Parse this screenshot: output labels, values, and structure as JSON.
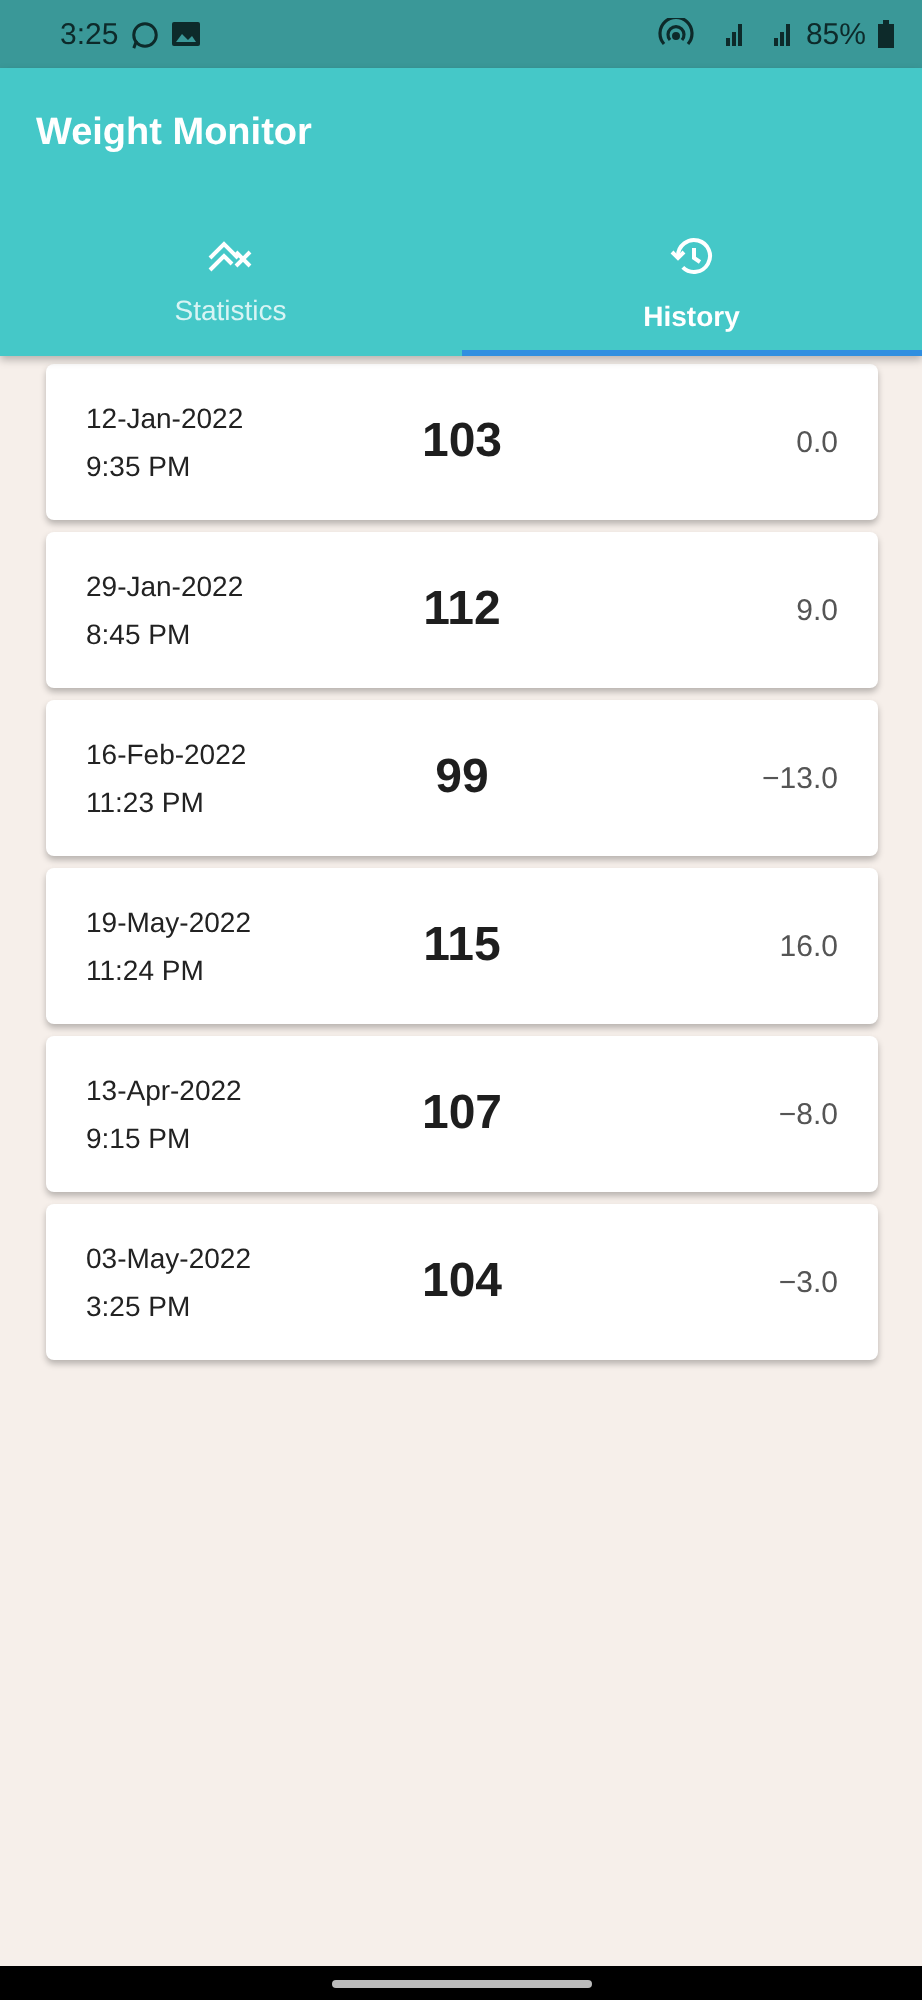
{
  "status_bar": {
    "time": "3:25",
    "battery": "85%"
  },
  "app_bar": {
    "title": "Weight Monitor"
  },
  "tabs": [
    {
      "label": "Statistics",
      "selected": false,
      "kind": "chart"
    },
    {
      "label": "History",
      "selected": true,
      "kind": "history"
    }
  ],
  "entries": [
    {
      "date": "12-Jan-2022",
      "time": "9:35 PM",
      "weight": "103",
      "change": "0.0"
    },
    {
      "date": "29-Jan-2022",
      "time": "8:45 PM",
      "weight": "112",
      "change": "9.0"
    },
    {
      "date": "16-Feb-2022",
      "time": "11:23 PM",
      "weight": "99",
      "change": "−13.0"
    },
    {
      "date": "19-May-2022",
      "time": "11:24 PM",
      "weight": "115",
      "change": "16.0"
    },
    {
      "date": "13-Apr-2022",
      "time": "9:15 PM",
      "weight": "107",
      "change": "−8.0"
    },
    {
      "date": "03-May-2022",
      "time": "3:25 PM",
      "weight": "104",
      "change": "−3.0"
    }
  ]
}
